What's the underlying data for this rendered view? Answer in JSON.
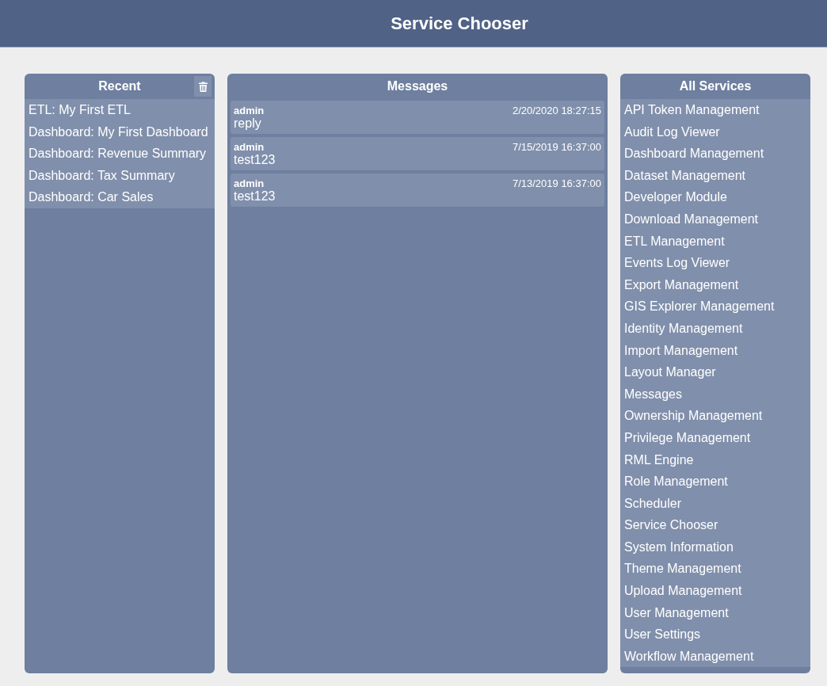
{
  "header": {
    "title": "Service Chooser"
  },
  "recent": {
    "title": "Recent",
    "items": [
      "ETL: My First ETL",
      "Dashboard: My First Dashboard",
      "Dashboard: Revenue Summary",
      "Dashboard: Tax Summary",
      "Dashboard: Car Sales"
    ]
  },
  "messages": {
    "title": "Messages",
    "items": [
      {
        "author": "admin",
        "time": "2/20/2020 18:27:15",
        "text": "reply"
      },
      {
        "author": "admin",
        "time": "7/15/2019 16:37:00",
        "text": "test123"
      },
      {
        "author": "admin",
        "time": "7/13/2019 16:37:00",
        "text": "test123"
      }
    ]
  },
  "all_services": {
    "title": "All Services",
    "items": [
      "API Token Management",
      "Audit Log Viewer",
      "Dashboard Management",
      "Dataset Management",
      "Developer Module",
      "Download Management",
      "ETL Management",
      "Events Log Viewer",
      "Export Management",
      "GIS Explorer Management",
      "Identity Management",
      "Import Management",
      "Layout Manager",
      "Messages",
      "Ownership Management",
      "Privilege Management",
      "RML Engine",
      "Role Management",
      "Scheduler",
      "Service Chooser",
      "System Information",
      "Theme Management",
      "Upload Management",
      "User Management",
      "User Settings",
      "Workflow Management"
    ]
  }
}
